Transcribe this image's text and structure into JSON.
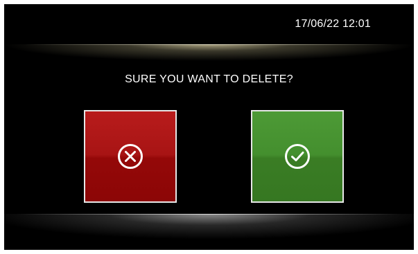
{
  "header": {
    "datetime": "17/06/22 12:01"
  },
  "dialog": {
    "question": "SURE YOU WANT TO DELETE?",
    "cancel_button": {
      "icon": "close-circle-icon",
      "color": "#a81414"
    },
    "confirm_button": {
      "icon": "check-circle-icon",
      "color": "#448f2e"
    }
  }
}
